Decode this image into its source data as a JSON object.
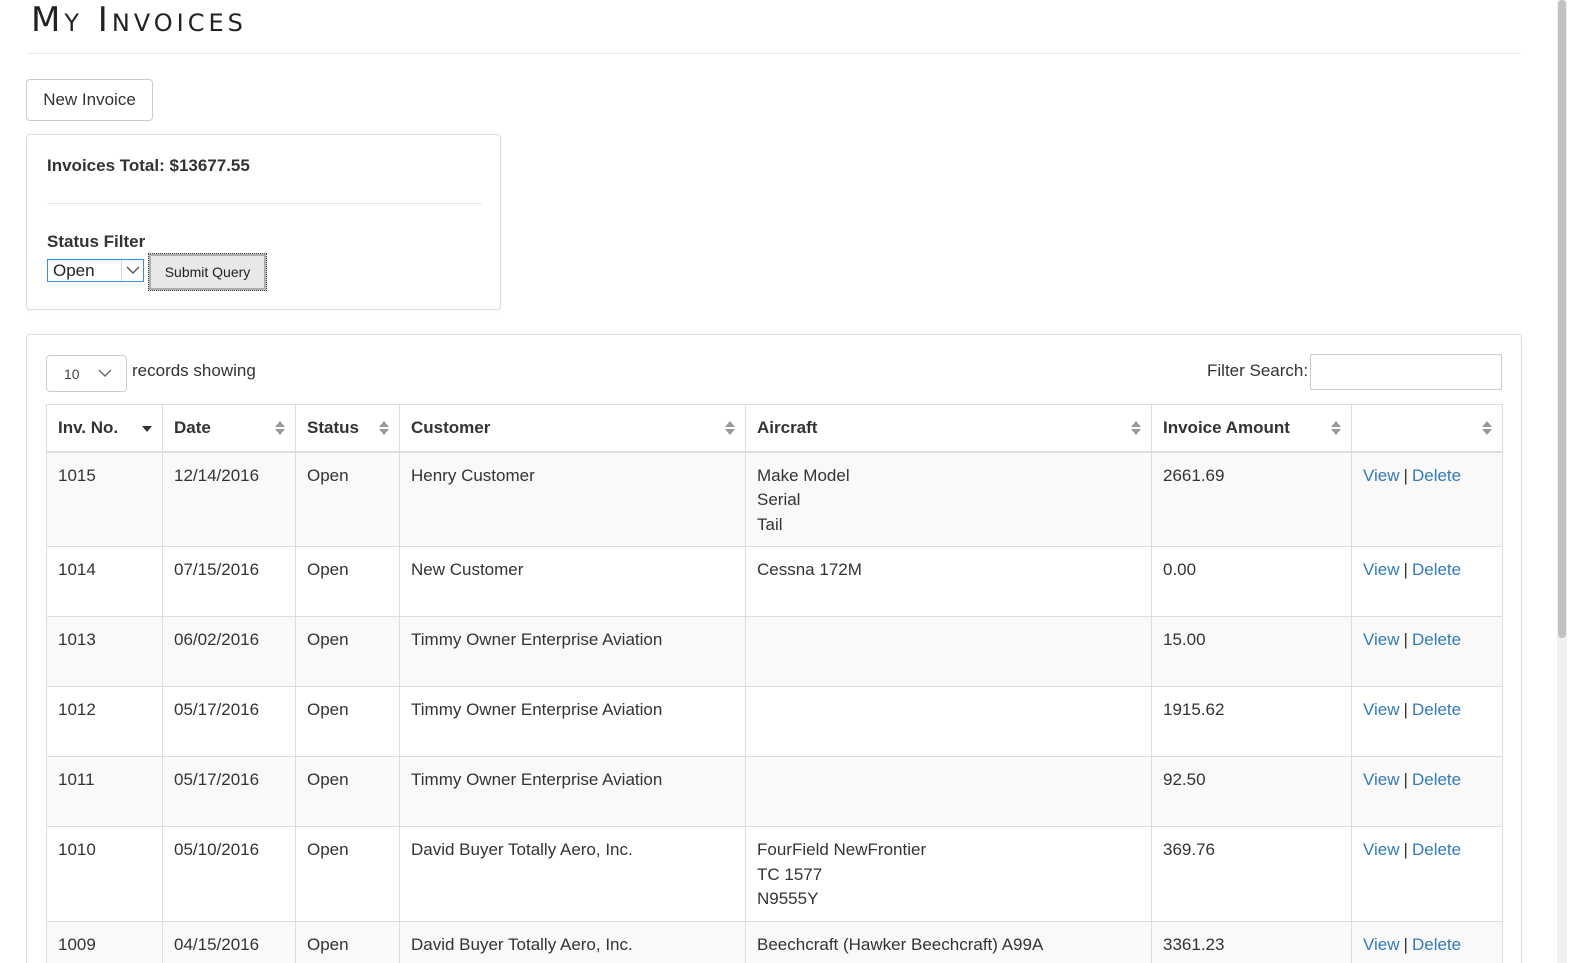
{
  "page": {
    "title": "My Invoices",
    "new_invoice_label": "New Invoice"
  },
  "summary": {
    "total_label": "Invoices Total: $13677.55",
    "status_filter_label": "Status Filter",
    "status_selected": "Open",
    "submit_label": "Submit Query"
  },
  "table_controls": {
    "length_value": "10",
    "length_label": "records showing",
    "filter_label": "Filter Search:",
    "filter_value": ""
  },
  "table": {
    "columns": [
      "Inv. No.",
      "Date",
      "Status",
      "Customer",
      "Aircraft",
      "Invoice Amount",
      ""
    ],
    "view_label": "View",
    "delete_label": "Delete",
    "rows": [
      {
        "inv": "1015",
        "date": "12/14/2016",
        "status": "Open",
        "customer": "Henry Customer",
        "aircraft": [
          "Make Model",
          "Serial",
          "Tail"
        ],
        "amount": "2661.69"
      },
      {
        "inv": "1014",
        "date": "07/15/2016",
        "status": "Open",
        "customer": "New Customer",
        "aircraft": [
          "Cessna 172M"
        ],
        "amount": "0.00"
      },
      {
        "inv": "1013",
        "date": "06/02/2016",
        "status": "Open",
        "customer": "Timmy Owner Enterprise Aviation",
        "aircraft": [],
        "amount": "15.00"
      },
      {
        "inv": "1012",
        "date": "05/17/2016",
        "status": "Open",
        "customer": "Timmy Owner Enterprise Aviation",
        "aircraft": [],
        "amount": "1915.62"
      },
      {
        "inv": "1011",
        "date": "05/17/2016",
        "status": "Open",
        "customer": "Timmy Owner Enterprise Aviation",
        "aircraft": [],
        "amount": "92.50"
      },
      {
        "inv": "1010",
        "date": "05/10/2016",
        "status": "Open",
        "customer": "David Buyer Totally Aero, Inc.",
        "aircraft": [
          "FourField NewFrontier",
          "TC 1577",
          "N9555Y"
        ],
        "amount": "369.76"
      },
      {
        "inv": "1009",
        "date": "04/15/2016",
        "status": "Open",
        "customer": "David Buyer Totally Aero, Inc.",
        "aircraft": [
          "Beechcraft (Hawker Beechcraft) A99A"
        ],
        "amount": "3361.23"
      }
    ]
  },
  "icons": {
    "sort_desc": "sort-desc-icon",
    "sort_both": "sort-both-icon",
    "chevron": "chevron-down-icon"
  },
  "colors": {
    "link": "#337ab7",
    "border": "#dddddd",
    "row_stripe": "#f9f9f9",
    "select_focus": "#3c8dde"
  }
}
